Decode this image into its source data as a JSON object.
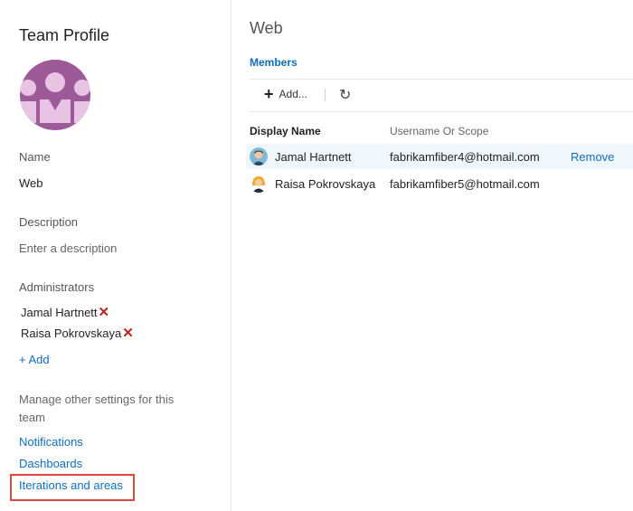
{
  "profile": {
    "title": "Team Profile",
    "name_label": "Name",
    "name_value": "Web",
    "description_label": "Description",
    "description_placeholder": "Enter a description",
    "administrators_label": "Administrators",
    "administrators": [
      {
        "name": "Jamal Hartnett"
      },
      {
        "name": "Raisa Pokrovskaya"
      }
    ],
    "add_admin_label": "+ Add",
    "manage_text": "Manage other settings for this team",
    "links": {
      "notifications": "Notifications",
      "dashboards": "Dashboards",
      "iterations": "Iterations and areas"
    }
  },
  "main": {
    "title": "Web",
    "tab": "Members",
    "toolbar": {
      "add_label": "Add..."
    },
    "columns": {
      "display": "Display Name",
      "user": "Username Or Scope"
    },
    "members": [
      {
        "name": "Jamal Hartnett",
        "email": "fabrikamfiber4@hotmail.com",
        "action": "Remove"
      },
      {
        "name": "Raisa Pokrovskaya",
        "email": "fabrikamfiber5@hotmail.com",
        "action": ""
      }
    ]
  },
  "colors": {
    "accent": "#106ebe",
    "avatar": "#9d5a98",
    "highlight": "#e0473c",
    "row_selected": "#eff6fc"
  }
}
